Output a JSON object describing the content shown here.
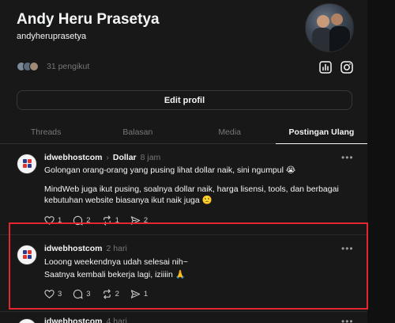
{
  "profile": {
    "name": "Andy Heru Prasetya",
    "handle": "andyheruprasetya",
    "followers_text": "31 pengikut",
    "edit_button": "Edit profil"
  },
  "icons": {
    "insights": "bar-chart-icon",
    "instagram": "instagram-icon"
  },
  "tabs": [
    {
      "label": "Threads"
    },
    {
      "label": "Balasan"
    },
    {
      "label": "Media"
    },
    {
      "label": "Postingan Ulang",
      "active": true
    }
  ],
  "posts": [
    {
      "username": "idwebhostcom",
      "topic": "Dollar",
      "time": "8 jam",
      "more": "•••",
      "paragraph1": "Golongan orang-orang yang pusing lihat dollar naik, sini ngumpul 😭",
      "paragraph2": "MindWeb juga ikut pusing, soalnya dollar naik, harga lisensi, tools, dan berbagai kebutuhan website biasanya ikut naik juga 🙁",
      "likes": "1",
      "replies": "2",
      "reposts": "1",
      "shares": "2"
    },
    {
      "username": "idwebhostcom",
      "time": "2 hari",
      "more": "•••",
      "line1": "Looong weekendnya udah selesai nih~",
      "line2": "Saatnya kembali bekerja lagi, iziiiin 🙏",
      "likes": "3",
      "replies": "3",
      "reposts": "2",
      "shares": "1"
    },
    {
      "username": "idwebhostcom",
      "time": "4 hari",
      "more": "•••"
    }
  ],
  "colors": {
    "background": "#101010",
    "panel": "#181818",
    "text": "#f3f5f7",
    "muted": "#777777",
    "highlight": "#e3262f"
  }
}
